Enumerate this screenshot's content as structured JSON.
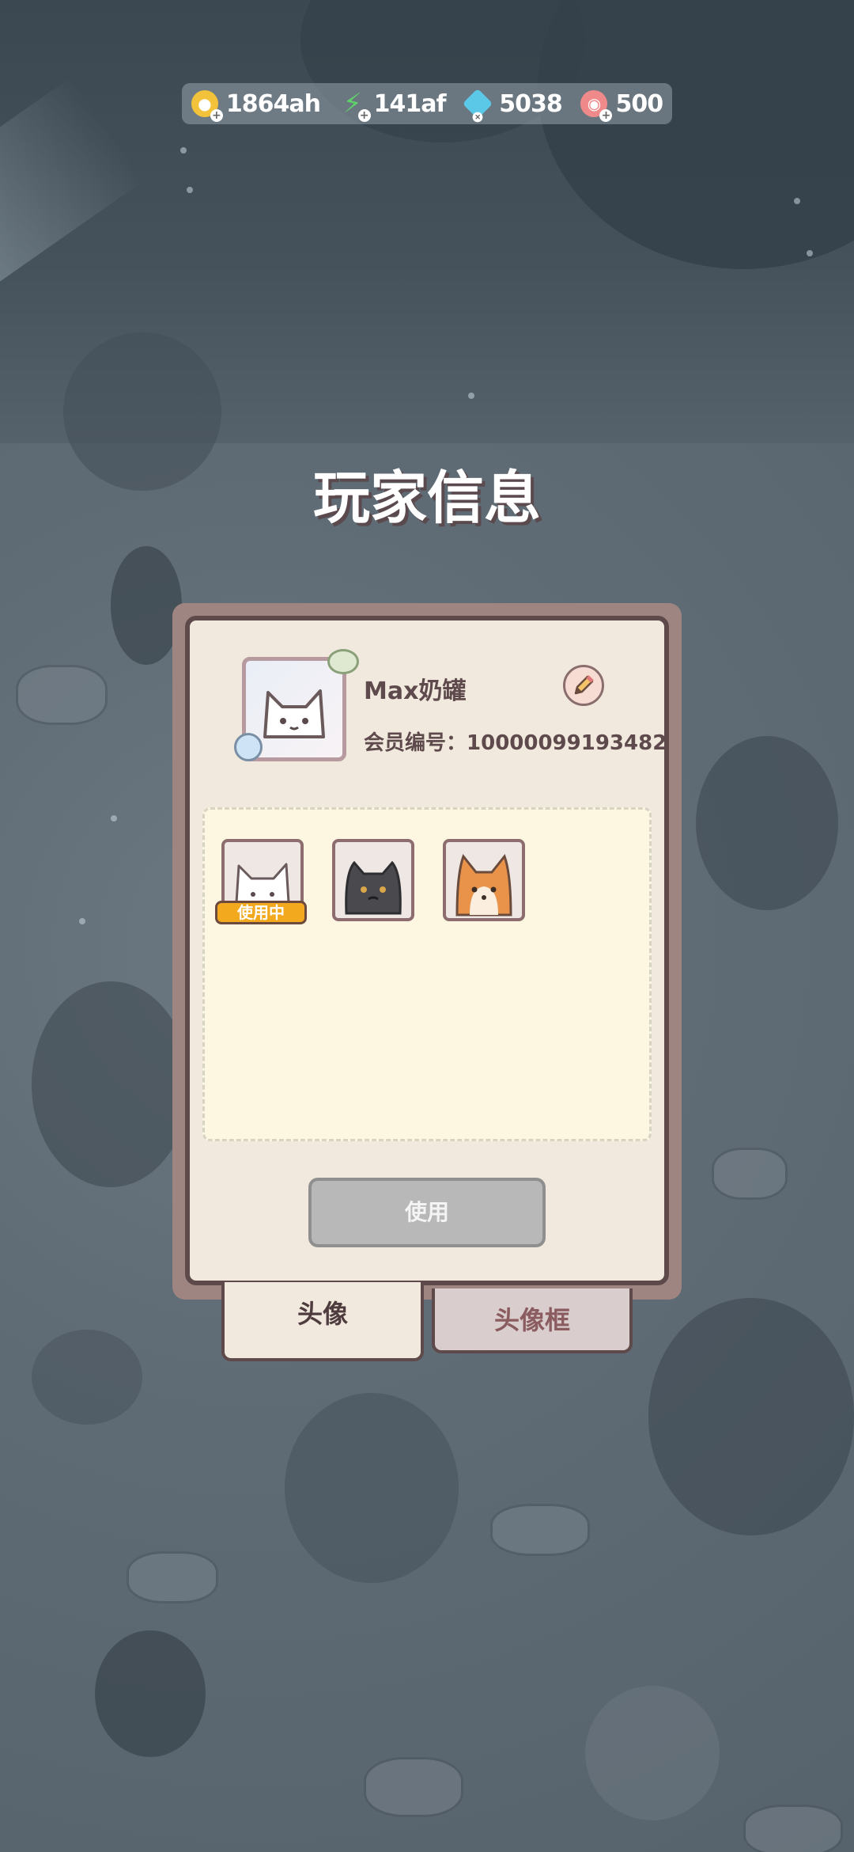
{
  "currencies": [
    {
      "icon": "coin-icon",
      "value": "1864ah",
      "color": "#f2c23a"
    },
    {
      "icon": "lightning-icon",
      "value": "141af",
      "color": "#5fd16a"
    },
    {
      "icon": "gem-icon",
      "value": "5038",
      "color": "#5cc8e8"
    },
    {
      "icon": "shell-icon",
      "value": "500",
      "color": "#f08a8a"
    }
  ],
  "title": "玩家信息",
  "profile": {
    "name": "Max奶罐",
    "member_label": "会员编号：",
    "member_id": "10000099193482"
  },
  "avatars": [
    {
      "name": "white-cat",
      "in_use": true
    },
    {
      "name": "black-cat",
      "in_use": false
    },
    {
      "name": "shiba-dog",
      "in_use": false
    }
  ],
  "in_use_label": "使用中",
  "use_button_label": "使用",
  "tabs": [
    {
      "label": "头像",
      "active": true
    },
    {
      "label": "头像框",
      "active": false
    }
  ]
}
